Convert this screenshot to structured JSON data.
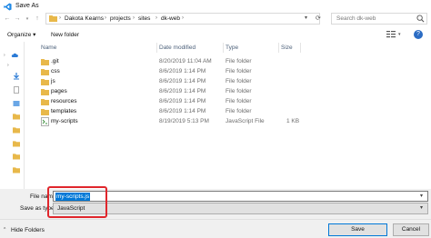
{
  "window": {
    "title": "Save As"
  },
  "address": {
    "breadcrumbs": [
      "Dakota Kearns",
      "projects",
      "sites",
      "dk-web"
    ],
    "search_placeholder": "Search dk-web"
  },
  "toolbar": {
    "organize": "Organize ▾",
    "new_folder": "New folder"
  },
  "columns": {
    "name": "Name",
    "date": "Date modified",
    "type": "Type",
    "size": "Size"
  },
  "files": [
    {
      "name": ".git",
      "date": "8/20/2019 11:04 AM",
      "type": "File folder",
      "size": "",
      "icon": "folder-icon"
    },
    {
      "name": "css",
      "date": "8/6/2019 1:14 PM",
      "type": "File folder",
      "size": "",
      "icon": "folder-icon"
    },
    {
      "name": "js",
      "date": "8/6/2019 1:14 PM",
      "type": "File folder",
      "size": "",
      "icon": "folder-icon"
    },
    {
      "name": "pages",
      "date": "8/6/2019 1:14 PM",
      "type": "File folder",
      "size": "",
      "icon": "folder-icon"
    },
    {
      "name": "resources",
      "date": "8/6/2019 1:14 PM",
      "type": "File folder",
      "size": "",
      "icon": "folder-icon"
    },
    {
      "name": "templates",
      "date": "8/6/2019 1:14 PM",
      "type": "File folder",
      "size": "",
      "icon": "folder-icon"
    },
    {
      "name": "my-scripts",
      "date": "8/19/2019 5:13 PM",
      "type": "JavaScript File",
      "size": "1 KB",
      "icon": "js-file-icon"
    }
  ],
  "save": {
    "file_name_label": "File name:",
    "file_name_value": "my-scripts.js",
    "save_as_type_label": "Save as type:",
    "save_as_type_value": "JavaScript"
  },
  "footer": {
    "hide_folders": "Hide Folders",
    "save_button": "Save",
    "cancel_button": "Cancel"
  },
  "colors": {
    "accent": "#0078d7",
    "highlight": "#e0262c",
    "folder": "#e8b84a"
  }
}
